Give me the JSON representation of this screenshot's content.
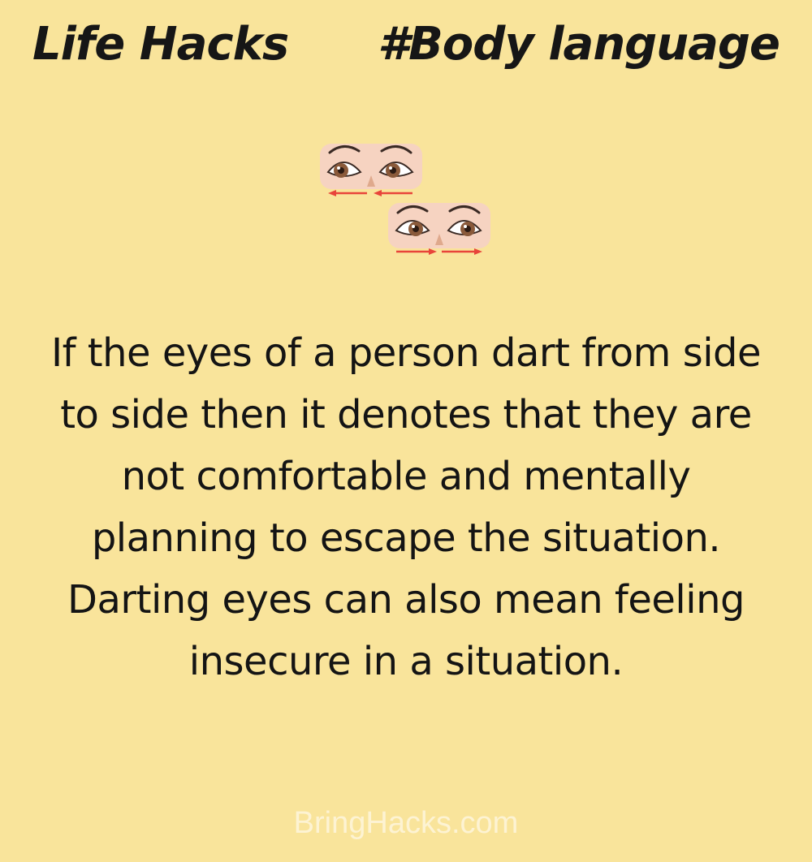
{
  "header": {
    "left_title": "Life Hacks",
    "right_title": "#Body language"
  },
  "illustration": {
    "icon": "darting-eyes-icon",
    "top_eyes_direction": "left",
    "bottom_eyes_direction": "right",
    "colors": {
      "skin": "#f6d3c1",
      "iris": "#8a5a3a",
      "arrow": "#e8443a",
      "brow": "#3a2a24"
    }
  },
  "body": {
    "text": "If the eyes of a person dart from side to side then it denotes that they are not comfortable and mentally planning to escape the situation. Darting eyes can also mean feeling insecure in a situation."
  },
  "footer": {
    "watermark": "BringHacks.com"
  },
  "colors": {
    "background": "#f9e49b",
    "text": "#141414",
    "watermark": "#fdf3d3"
  }
}
